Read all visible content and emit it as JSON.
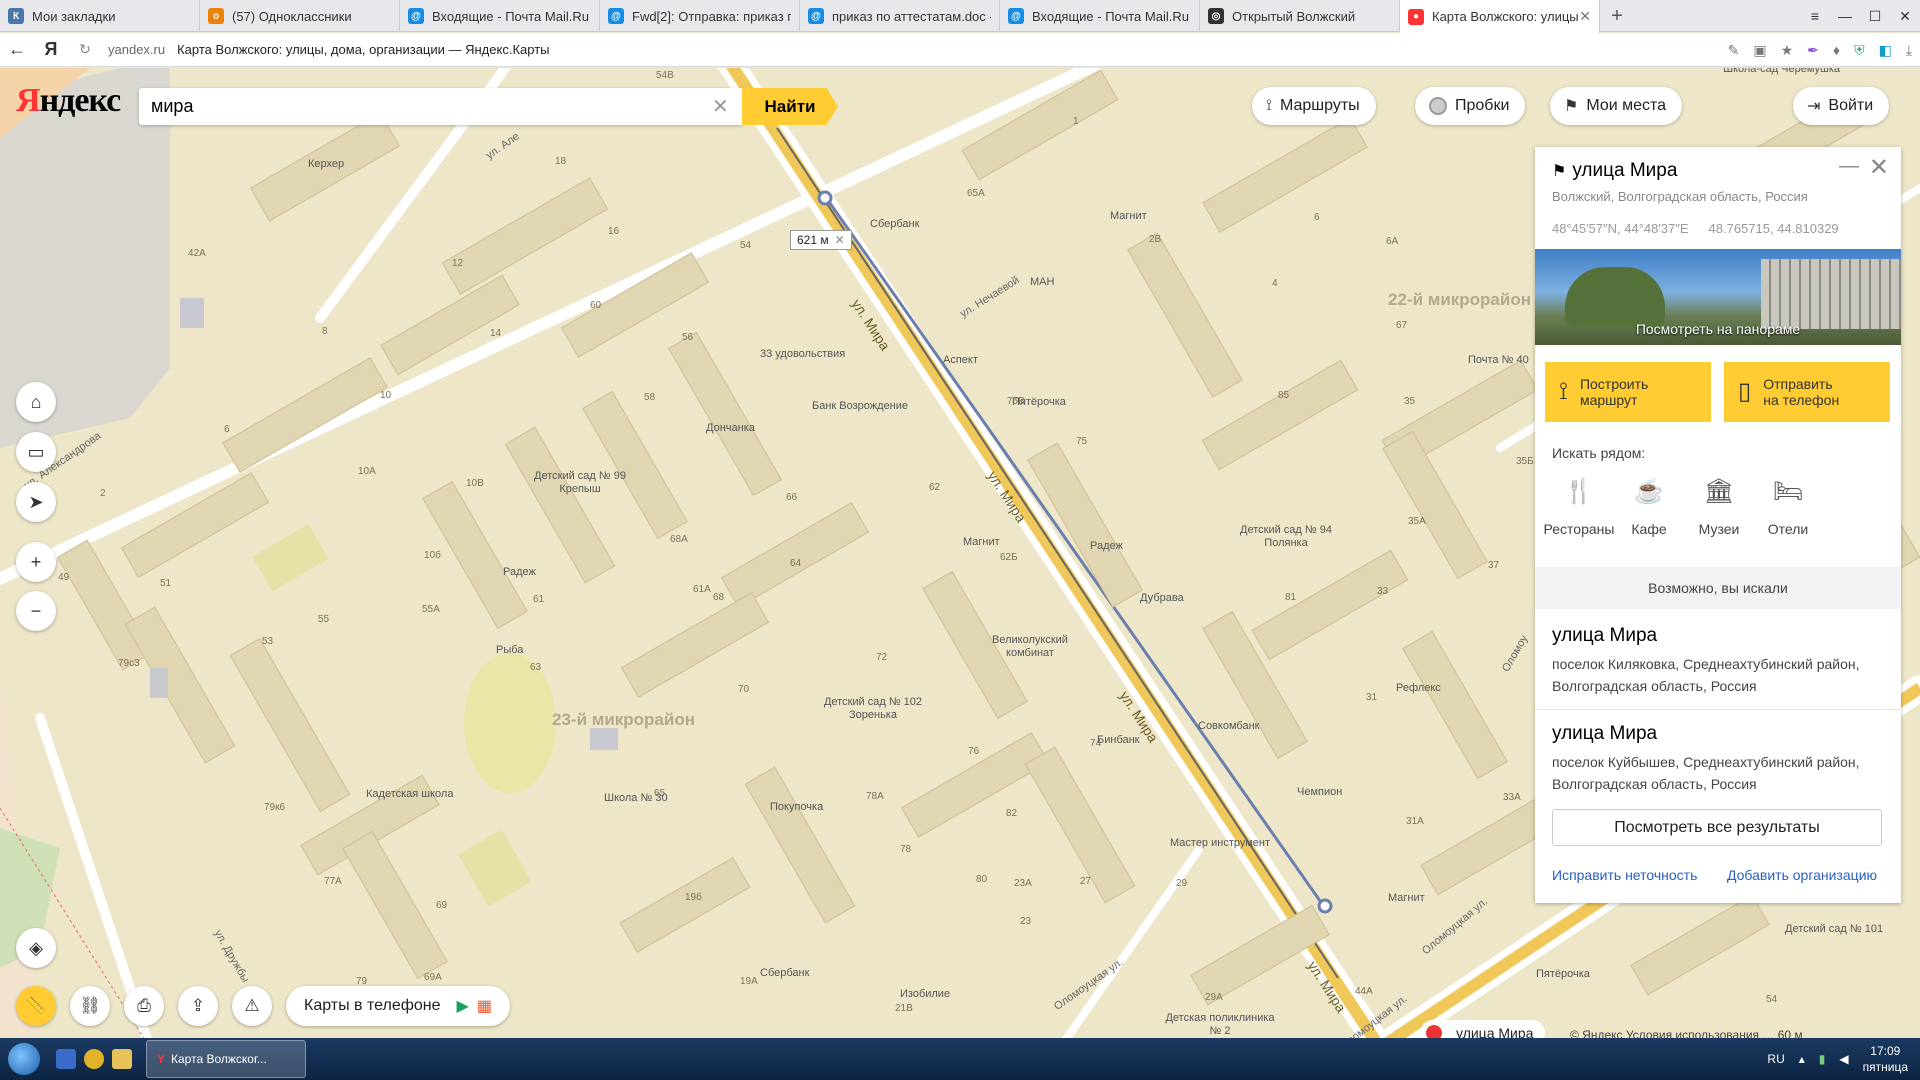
{
  "browser": {
    "tabs": [
      {
        "label": "Мои закладки",
        "icon": "vk-icon",
        "color": "#4a76a8",
        "glyph": "К"
      },
      {
        "label": "(57) Одноклассники",
        "icon": "odnoklassniki-icon",
        "color": "#ee8208",
        "glyph": "о"
      },
      {
        "label": "Входящие - Почта Mail.Ru",
        "icon": "mailru-icon",
        "color": "#168de2",
        "glyph": "@"
      },
      {
        "label": "Fwd[2]: Отправка: приказ п",
        "icon": "mailru-icon",
        "color": "#168de2",
        "glyph": "@"
      },
      {
        "label": "приказ по аттестатам.doc -",
        "icon": "mailru-icon",
        "color": "#168de2",
        "glyph": "@"
      },
      {
        "label": "Входящие - Почта Mail.Ru",
        "icon": "mailru-icon",
        "color": "#168de2",
        "glyph": "@"
      },
      {
        "label": "Открытый Волжский",
        "icon": "site-icon",
        "color": "#333333",
        "glyph": "◎"
      },
      {
        "label": "Карта Волжского: улицы",
        "icon": "map-pin-icon",
        "color": "#ff3333",
        "glyph": "●",
        "active": true
      }
    ],
    "url_domain": "yandex.ru",
    "page_title": "Карта Волжского: улицы, дома, организации — Яндекс.Карты"
  },
  "header": {
    "logo_red": "Я",
    "logo_black": "ндекс",
    "search_value": "мира",
    "find_label": "Найти",
    "routes_label": "Маршруты",
    "traffic_label": "Пробки",
    "myplaces_label": "Мои места",
    "login_label": "Войти"
  },
  "controls": {
    "mobile_label": "Карты в телефоне"
  },
  "map": {
    "distance": "621 м",
    "districts": [
      "22-й микрорайон",
      "23-й микрорайон"
    ],
    "streets": [
      "ул. Мира",
      "ул. Мира",
      "ул. Мира",
      "ул. Мира",
      "ул. Нечаевой",
      "ул. Александрова",
      "ул. Але",
      "ул. Дружбы",
      "Оломоуцкая ул.",
      "Оломоуцкая ул.",
      "Оломоуцкая ул.",
      "Оломоу"
    ],
    "pois": [
      "Керхер",
      "Сбербанк",
      "Магнит",
      "МАН",
      "Аспект",
      "33 удовольствия",
      "Банк Возрождение",
      "Пятёрочка",
      "Дончанка",
      "Детский сад № 99 Крепыш",
      "Радеж",
      "Магнит",
      "Радеж",
      "Дубрава",
      "Детский сад № 94 Полянка",
      "Почта № 40",
      "Рыба",
      "Великолукский комбинат",
      "Детский сад № 102 Зоренька",
      "Кадетская школа",
      "Школа № 30",
      "Покупочка",
      "Бинбанк",
      "Совкомбанк",
      "Рефлекс",
      "Чемпион",
      "Мастер инструмент",
      "Магнит",
      "Детский сад № 101",
      "Пятёрочка",
      "Сбербанк",
      "Изобилие",
      "Детская поликлиника № 2",
      "Школа-сад Черемушка"
    ],
    "house_numbers": [
      "54В",
      "18",
      "16",
      "12",
      "42А",
      "14",
      "8",
      "10",
      "6",
      "10А",
      "10В",
      "10б",
      "2",
      "49",
      "51",
      "55",
      "55А",
      "53",
      "79с3",
      "79к6",
      "77А",
      "79",
      "69",
      "69А",
      "60",
      "58",
      "56",
      "54",
      "66",
      "68А",
      "68",
      "64",
      "61А",
      "61",
      "63",
      "62",
      "62Б",
      "65А",
      "75В",
      "75",
      "72",
      "70",
      "65",
      "76",
      "78А",
      "78",
      "82",
      "80",
      "23А",
      "23",
      "27",
      "29",
      "74",
      "19б",
      "19А",
      "21В",
      "1",
      "2В",
      "6",
      "6А",
      "4",
      "67",
      "85",
      "35",
      "35Б",
      "35А",
      "81",
      "37",
      "33",
      "31",
      "31А",
      "33А",
      "44А",
      "54",
      "29А"
    ]
  },
  "panel": {
    "title": "улица Мира",
    "address": "Волжский, Волгоградская область, Россия",
    "coords_dms": "48°45′57″N, 44°48′37″E",
    "coords_dec": "48.765715, 44.810329",
    "pano_label": "Посмотреть на панораме",
    "route_label_1": "Построить",
    "route_label_2": "маршрут",
    "send_label_1": "Отправить",
    "send_label_2": "на телефон",
    "nearby_title": "Искать рядом:",
    "nearby": [
      {
        "label": "Рестораны",
        "icon": "restaurant-icon",
        "glyph": "🍴"
      },
      {
        "label": "Кафе",
        "icon": "cafe-icon",
        "glyph": "☕"
      },
      {
        "label": "Музеи",
        "icon": "museum-icon",
        "glyph": "🏛"
      },
      {
        "label": "Отели",
        "icon": "hotel-icon",
        "glyph": "🛏"
      }
    ],
    "maybe_title": "Возможно, вы искали",
    "results": [
      {
        "title": "улица Мира",
        "desc1": "поселок Киляковка, Среднеахтубинский район,",
        "desc2": "Волгоградская область, Россия"
      },
      {
        "title": "улица Мира",
        "desc1": "поселок Куйбышев, Среднеахтубинский район,",
        "desc2": "Волгоградская область, Россия"
      }
    ],
    "all_results_label": "Посмотреть все результаты",
    "fix_label": "Исправить неточность",
    "add_org_label": "Добавить организацию"
  },
  "map_footer": {
    "pin_label": "улица Мира",
    "copyright": "© Яндекс Условия использования … 60 м"
  },
  "taskbar": {
    "task_label": "Карта Волжског...",
    "lang": "RU",
    "time": "17:09",
    "day": "пятница"
  }
}
